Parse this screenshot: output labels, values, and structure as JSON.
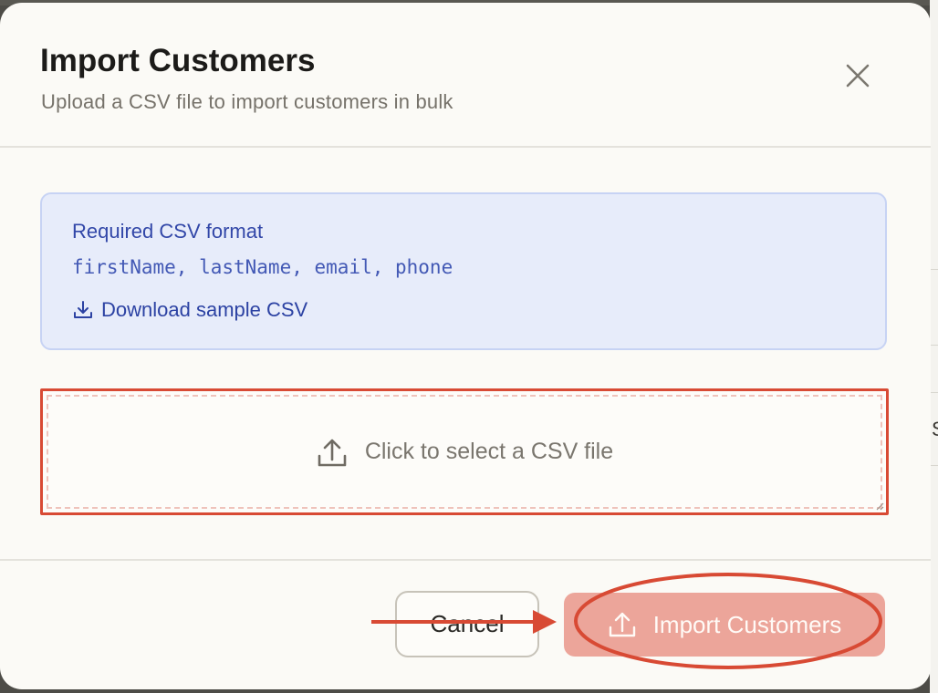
{
  "dialog": {
    "title": "Import Customers",
    "subtitle": "Upload a CSV file to import customers in bulk",
    "close_icon": "close-icon"
  },
  "info": {
    "title": "Required CSV format",
    "format": "firstName, lastName, email, phone",
    "download_label": "Download sample CSV",
    "download_icon": "download-icon"
  },
  "dropzone": {
    "label": "Click to select a CSV file",
    "icon": "upload-icon"
  },
  "footer": {
    "cancel_label": "Cancel",
    "import_label": "Import Customers",
    "import_icon": "upload-icon"
  },
  "background": {
    "partial_glyph": "S"
  },
  "colors": {
    "accent": "#eca59a",
    "info_bg": "#e7ecfa",
    "info_text": "#3247a8",
    "annotation": "#d84a34"
  }
}
